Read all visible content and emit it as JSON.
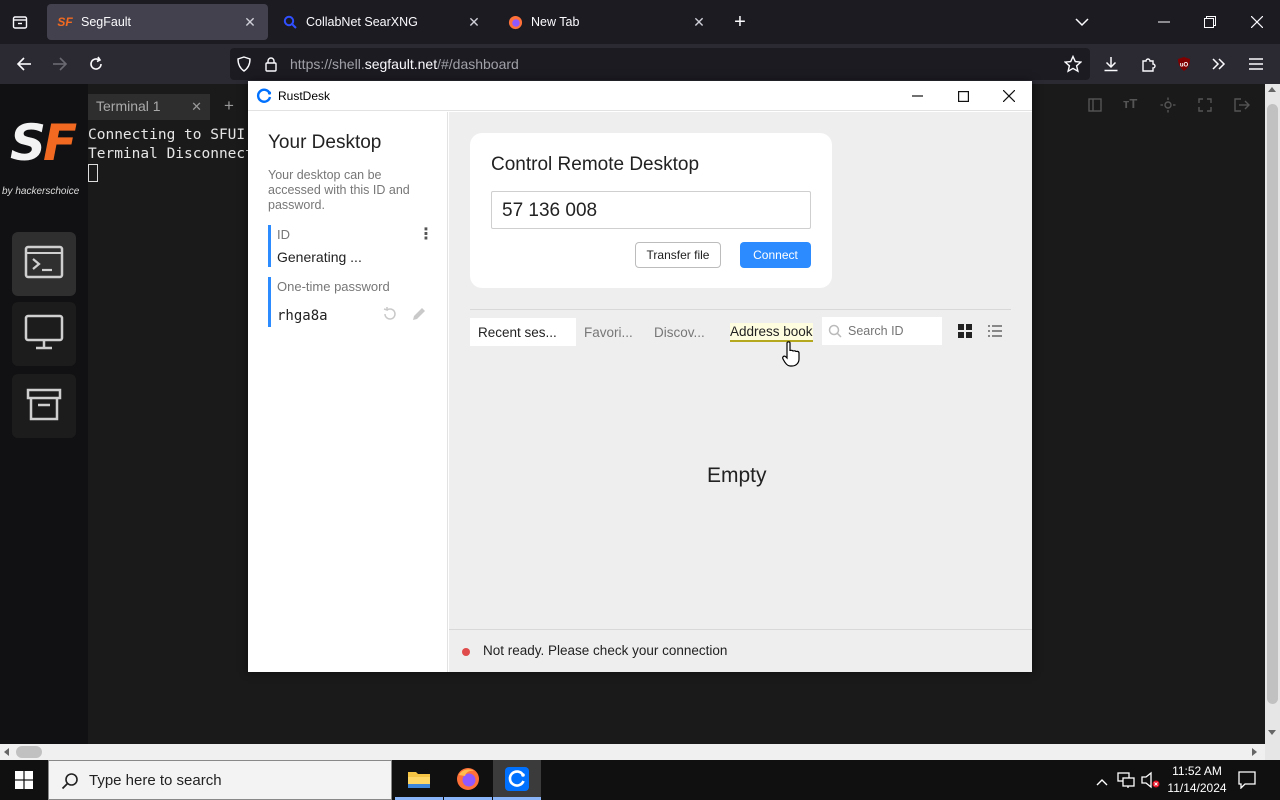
{
  "browser": {
    "tabs": [
      {
        "label": "SegFault",
        "active": true
      },
      {
        "label": "CollabNet SearXNG",
        "active": false
      },
      {
        "label": "New Tab",
        "active": false
      }
    ],
    "url": {
      "prefix": "https://shell.",
      "host": "segfault.net",
      "suffix": "/#/dashboard"
    }
  },
  "segfault": {
    "logo_s": "S",
    "logo_f": "F",
    "byline": "by hackerschoice",
    "terminal_tab": "Terminal 1",
    "terminal_lines": "Connecting to SFUI\nTerminal Disconnect"
  },
  "rustdesk": {
    "window_title": "RustDesk",
    "your_desktop_title": "Your Desktop",
    "your_desktop_desc": "Your desktop can be accessed with this ID and password.",
    "id_label": "ID",
    "id_value": "Generating ...",
    "otp_label": "One-time password",
    "otp_value": "rhga8a",
    "control_title": "Control Remote Desktop",
    "remote_id_value": "57 136 008",
    "transfer_file_label": "Transfer file",
    "connect_label": "Connect",
    "peer_tabs": [
      "Recent ses...",
      "Favori...",
      "Discov...",
      "Address book"
    ],
    "search_placeholder": "Search ID",
    "empty_text": "Empty",
    "status_text": "Not ready. Please check your connection",
    "status_color": "#e04b4b",
    "accent_color": "#2c8cff"
  },
  "taskbar": {
    "search_placeholder": "Type here to search",
    "time": "11:52 AM",
    "date": "11/14/2024"
  }
}
